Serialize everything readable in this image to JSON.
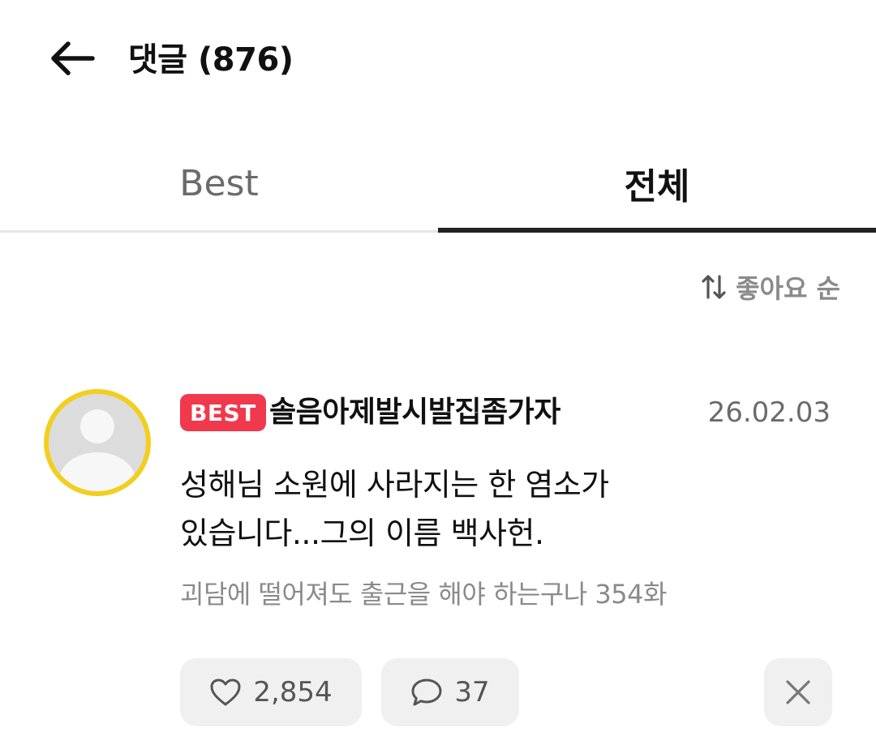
{
  "header": {
    "title": "댓글 (876)",
    "back_icon": "arrow-left-icon"
  },
  "tabs": [
    {
      "label": "Best",
      "active": false
    },
    {
      "label": "전체",
      "active": true
    }
  ],
  "sort": {
    "label": "좋아요 순",
    "icon": "sort-arrows-icon"
  },
  "comment": {
    "badge": "BEST",
    "author": "솔음아제발시발집좀가자",
    "date": "26.02.03",
    "content_lines": [
      "성해님 소원에 사라지는 한 염소가",
      "있습니다...그의 이름 백사헌."
    ],
    "episode": "괴담에 떨어져도 출근을 해야 하는구나 354화",
    "likes": "2,854",
    "replies": "37",
    "avatar_border_color": "#f2cf1f",
    "badge_color": "#f0394d"
  }
}
